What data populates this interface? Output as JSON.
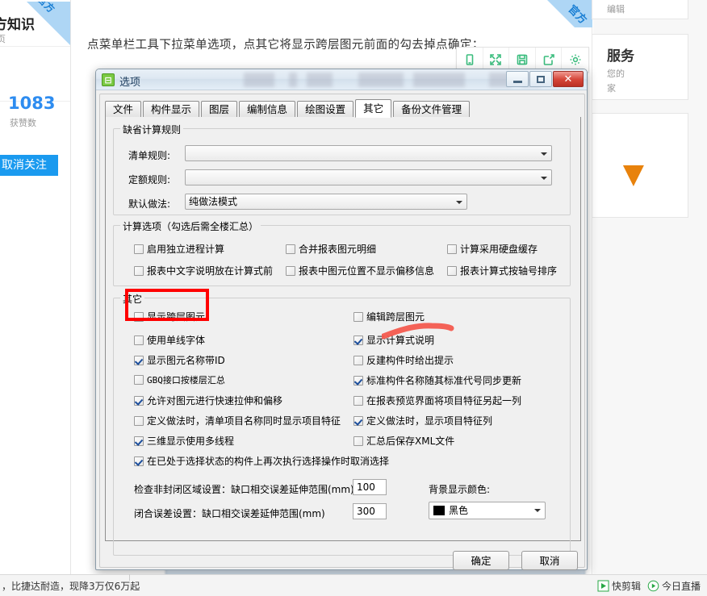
{
  "webpage": {
    "badge_text": "官方",
    "author": {
      "name": "方知识",
      "subtitle": "页",
      "likes_count": "1083",
      "likes_label": "获赞数",
      "follow_button": "取消关注"
    },
    "article_text": "点菜单栏工具下拉菜单选项，点其它将显示跨层图元前面的勾去掉点确定；",
    "toolbar_icons": [
      {
        "name": "mobile-icon",
        "label": "手机预览"
      },
      {
        "name": "expand-icon",
        "label": "全屏"
      },
      {
        "name": "save-icon",
        "label": "保存"
      },
      {
        "name": "share-icon",
        "label": "分享"
      },
      {
        "name": "gear-icon",
        "label": "设置"
      }
    ],
    "right_rail": {
      "card1_text": "编辑",
      "card2_title": "服务",
      "card2_line1": "您的",
      "card2_line2": "家"
    }
  },
  "taskbar": {
    "ad_text": "，比捷达耐造，现降3万仅6万起",
    "items": [
      {
        "icon": "play-icon",
        "label": "快剪辑"
      },
      {
        "icon": "live-icon",
        "label": "今日直播"
      }
    ]
  },
  "dialog": {
    "title": "选项",
    "title_icon": "options-icon",
    "window_buttons": {
      "minimize": "minimize-button",
      "maximize": "maximize-button",
      "close": "✕"
    },
    "tabs": [
      {
        "label": "文件",
        "active": false
      },
      {
        "label": "构件显示",
        "active": false
      },
      {
        "label": "图层",
        "active": false
      },
      {
        "label": "编制信息",
        "active": false
      },
      {
        "label": "绘图设置",
        "active": false
      },
      {
        "label": "其它",
        "active": true
      },
      {
        "label": "备份文件管理",
        "active": false
      }
    ],
    "group_default_rules": {
      "title": "缺省计算规则",
      "fields": [
        {
          "label": "清单规则:",
          "value": "",
          "placeholder": ""
        },
        {
          "label": "定额规则:",
          "value": "",
          "placeholder": ""
        },
        {
          "label": "默认做法:",
          "value": "纯做法模式",
          "placeholder": ""
        }
      ]
    },
    "group_calc_options": {
      "title": "计算选项（勾选后需全楼汇总）",
      "checkboxes": [
        {
          "label": "启用独立进程计算",
          "checked": false
        },
        {
          "label": "合并报表图元明细",
          "checked": false
        },
        {
          "label": "计算采用硬盘缓存",
          "checked": false
        },
        {
          "label": "报表中文字说明放在计算式前",
          "checked": false
        },
        {
          "label": "报表中图元位置不显示偏移信息",
          "checked": false
        },
        {
          "label": "报表计算式按轴号排序",
          "checked": false
        }
      ]
    },
    "group_other": {
      "title": "其它",
      "left_checkboxes": [
        {
          "label": "显示跨层图元",
          "checked": false,
          "highlighted": true
        },
        {
          "label": "使用单线字体",
          "checked": false
        },
        {
          "label": "显示图元名称带ID",
          "checked": true
        },
        {
          "label": "GBQ接口按楼层汇总",
          "checked": false
        },
        {
          "label": "允许对图元进行快速拉伸和偏移",
          "checked": true
        },
        {
          "label": "定义做法时，清单项目名称同时显示项目特征",
          "checked": false
        },
        {
          "label": "三维显示使用多线程",
          "checked": true
        },
        {
          "label": "在已处于选择状态的构件上再次执行选择操作时取消选择",
          "checked": true
        }
      ],
      "right_checkboxes": [
        {
          "label": "编辑跨层图元",
          "checked": false
        },
        {
          "label": "显示计算式说明",
          "checked": true
        },
        {
          "label": "反建构件时给出提示",
          "checked": false
        },
        {
          "label": "标准构件名称随其标准代号同步更新",
          "checked": true
        },
        {
          "label": "在报表预览界面将项目特征另起一列",
          "checked": false
        },
        {
          "label": "定义做法时，显示项目特征列",
          "checked": true
        },
        {
          "label": "汇总后保存XML文件",
          "checked": false
        }
      ],
      "numeric_fields": [
        {
          "label": "检查非封闭区域设置：缺口相交误差延伸范围(mm)",
          "value": "100"
        },
        {
          "label": "闭合误差设置：缺口相交误差延伸范围(mm)",
          "value": "300"
        }
      ],
      "color_field": {
        "label": "背景显示颜色:",
        "value": "黑色",
        "swatch_color": "#000000"
      }
    },
    "footer_buttons": [
      {
        "label": "确定",
        "name": "ok-button"
      },
      {
        "label": "取消",
        "name": "cancel-button"
      }
    ]
  },
  "annotations": {
    "red_box_color": "#ff0000",
    "red_stroke_color": "#f4564a"
  }
}
